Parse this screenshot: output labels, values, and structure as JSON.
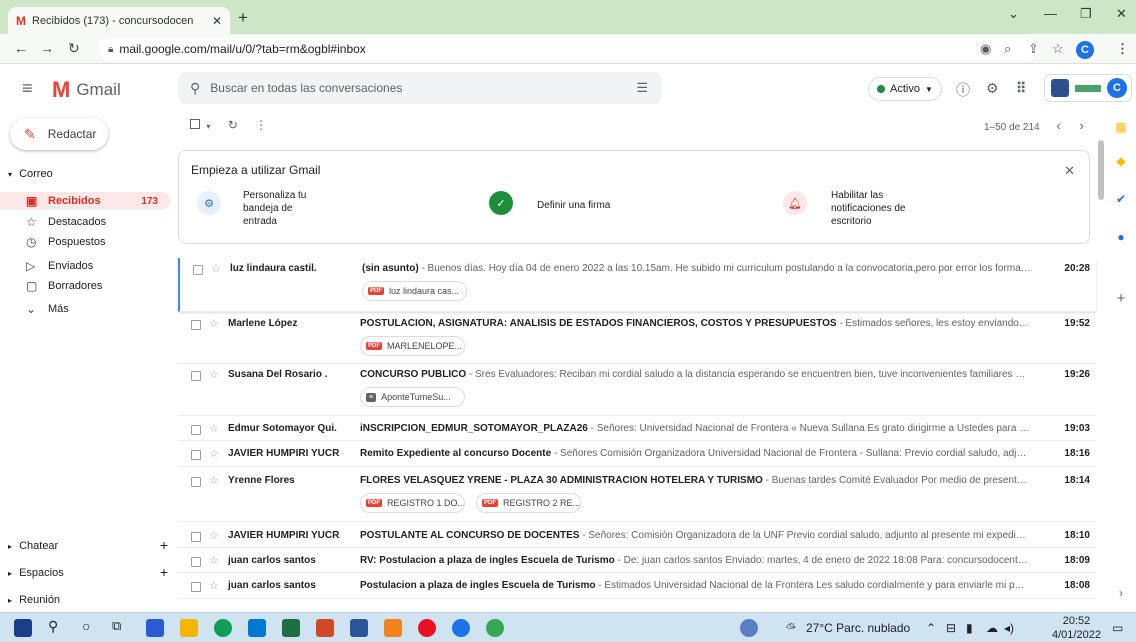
{
  "browser": {
    "tab_title": "Recibidos (173) - concursodocen",
    "tab_icon": "M",
    "url": "mail.google.com/mail/u/0/?tab=rm&ogbl#inbox",
    "avatar_letter": "C"
  },
  "header": {
    "app_name": "Gmail",
    "search_placeholder": "Buscar en todas las conversaciones",
    "status_label": "Activo",
    "avatar_letter": "C"
  },
  "sidebar": {
    "compose_label": "Redactar",
    "section_label": "Correo",
    "items": [
      {
        "label": "Recibidos",
        "count": "173",
        "icon": "inbox-icon"
      },
      {
        "label": "Destacados",
        "count": "",
        "icon": "star-icon"
      },
      {
        "label": "Pospuestos",
        "count": "",
        "icon": "clock-icon"
      },
      {
        "label": "Enviados",
        "count": "",
        "icon": "send-icon"
      },
      {
        "label": "Borradores",
        "count": "",
        "icon": "draft-icon"
      },
      {
        "label": "Más",
        "count": "",
        "icon": "chevron-down-icon"
      }
    ],
    "chat_label": "Chatear",
    "spaces_label": "Espacios",
    "meet_label": "Reunión"
  },
  "toolbar": {
    "pagination": "1–50 de 214"
  },
  "onboarding": {
    "title": "Empieza a utilizar Gmail",
    "steps": [
      {
        "text": "Personaliza tu bandeja de entrada"
      },
      {
        "text": "Definir una firma"
      },
      {
        "text": "Habilitar las notificaciones de escritorio"
      }
    ]
  },
  "emails": [
    {
      "sender": "luz lindaura castil.",
      "subject": "(sin asunto)",
      "snippet": " - Buenos días. Hoy día 04 de enero 2022 a las 10.15am. He subido mi curriculum postulando a la convocatoria,pero por error los formatos no ...",
      "time": "20:28",
      "attachments": [
        "luz lindaura cas..."
      ]
    },
    {
      "sender": "Marlene López",
      "subject": "POSTULACION, ASIGNATURA: ANALISIS DE ESTADOS FINANCIEROS, COSTOS Y PRESUPUESTOS",
      "snippet": " - Estimados señores, les estoy enviando mi cv para po...",
      "time": "19:52",
      "attachments": [
        "MARLENELOPE..."
      ]
    },
    {
      "sender": "Susana Del Rosario .",
      "subject": "CONCURSO PÚBLICO",
      "snippet": " - Sres Evaluadores: Reciban mi cordial saludo a la distancia esperando se encuentren bien, tuve inconvenientes familiares y de cone...",
      "time": "19:26",
      "attachments": [
        "AponteTumeSu..."
      ]
    },
    {
      "sender": "Edmur Sotomayor Qui.",
      "subject": "iNSCRIPCION_EDMUR_SOTOMAYOR_PLAZA26",
      "snippet": " - Señores: Universidad Nacional de Frontera « Nueva Sullana Es grato dirigirme a Ustedes para saludarles ...",
      "time": "19:03",
      "attachments": []
    },
    {
      "sender": "JAVIER HUMPIRI YUCRA",
      "subject": "Remito Expediente al concurso Docente",
      "snippet": " - Señores Comisión Organizadora Universidad Nacional de Frontera - Sullana: Previo cordial saludo, adjunto al pre...",
      "time": "18:16",
      "attachments": []
    },
    {
      "sender": "Yrenne Flores",
      "subject": "FLORES VELASQUEZ YRENE - PLAZA 30 ADMINISTRACION HOTELERA Y TURISMO",
      "snippet": " - Buenas tardes Comité Evaluador Por medio de presente, envío los r...",
      "time": "18:14",
      "attachments": [
        "REGISTRO 1 DO...",
        "REGISTRO 2 RE..."
      ]
    },
    {
      "sender": "JAVIER HUMPIRI YUCRA",
      "subject": "POSTULANTE AL CONCURSO DE DOCENTES",
      "snippet": " - Señores: Comisión Organizadora de la UNF Previo cordial saludo, adjunto al presente mi expediente para s...",
      "time": "18:10",
      "attachments": []
    },
    {
      "sender": "juan carlos santos",
      "subject": "RV: Postulacion a plaza de ingles Escuela de Turismo",
      "snippet": " - De: juan carlos santos Enviado: martes, 4 de enero de 2022 18:08 Para: concursodocente@unf.ed...",
      "time": "18:09",
      "attachments": []
    },
    {
      "sender": "juan carlos santos",
      "subject": "Postulacion a plaza de ingles Escuela de Turismo",
      "snippet": " - Estimados Universidad Nacional de la Frontera Les saludo cordialmente y para enviarle mi postulacion...",
      "time": "18:08",
      "attachments": []
    }
  ],
  "taskbar": {
    "weather": "27°C  Parc. nublado",
    "time": "20:52",
    "date": "4/01/2022"
  }
}
